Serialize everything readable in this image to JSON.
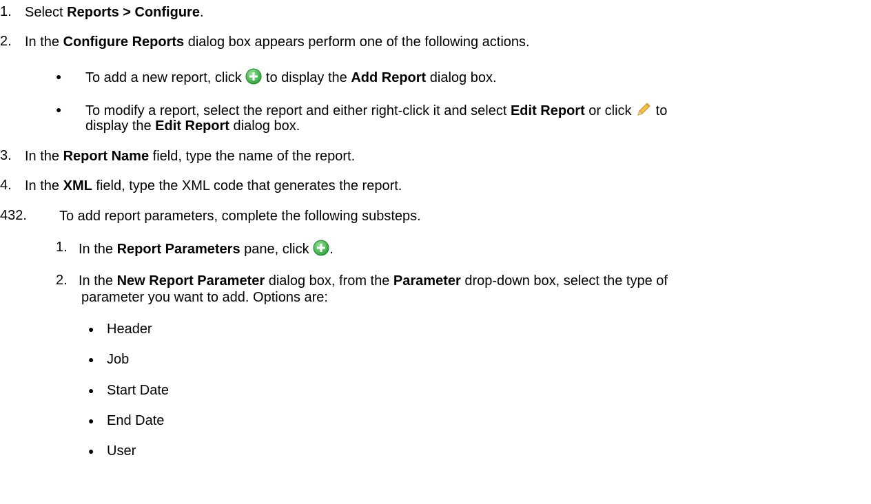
{
  "steps": {
    "s1": {
      "num": "1.",
      "pre": "Select ",
      "bold": "Reports > Configure",
      "post": "."
    },
    "s2": {
      "num": "2.",
      "pre": "In the ",
      "bold": "Configure Reports",
      "post": " dialog box appears perform one of the following actions."
    },
    "s2_b1": {
      "pre": "To add a new report, click ",
      "mid": " to display the ",
      "bold": "Add Report",
      "post": " dialog box."
    },
    "s2_b2": {
      "pre": "To modify a report, select the report and either right-click it and select ",
      "bold1": "Edit Report",
      "mid": " or click ",
      "post_icon": " to",
      "line2_pre": "display the ",
      "bold2": "Edit Report",
      "line2_post": " dialog box."
    },
    "s3": {
      "num": "3.",
      "pre": "In the ",
      "bold": "Report Name",
      "post": " field, type the name of the report."
    },
    "s4": {
      "num": "4.",
      "pre": "In the ",
      "bold": "XML",
      "post": " field, type the XML code that generates the report."
    },
    "s5": {
      "num": "432.",
      "text": "To add report parameters, complete the following substeps."
    },
    "sub1": {
      "num": "1.",
      "pre": "In the ",
      "bold": "Report Parameters",
      "post": " pane, click ",
      "end": "."
    },
    "sub2": {
      "num": "2.",
      "pre": "In the ",
      "bold1": "New Report Parameter",
      "mid": " dialog box, from the ",
      "bold2": "Parameter",
      "post": " drop-down box, select the type of",
      "line2": "parameter you want to add. Options are:"
    },
    "options": [
      "Header",
      "Job",
      "Start Date",
      "End Date",
      "User"
    ]
  },
  "icons": {
    "add": "add-icon",
    "edit": "pencil-icon"
  },
  "colors": {
    "add_green": "#3cb54a",
    "pencil": "#e8b23a"
  }
}
